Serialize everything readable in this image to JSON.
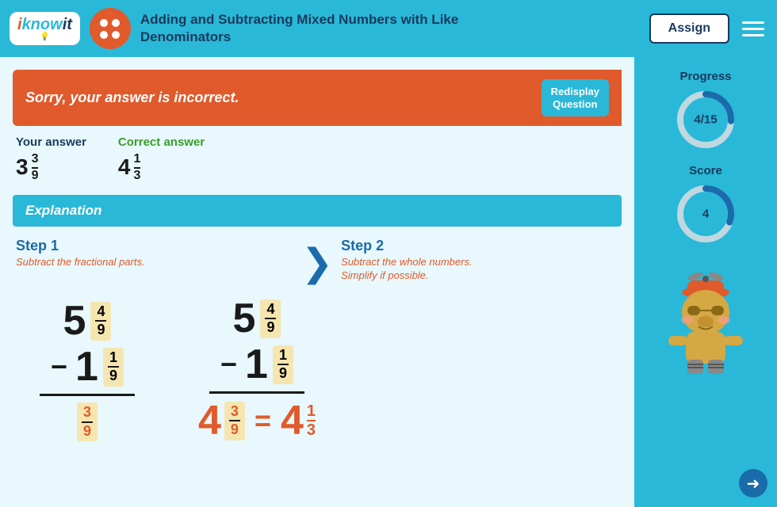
{
  "header": {
    "logo_i": "i",
    "logo_know": "know",
    "logo_it": "it",
    "title_line1": "Adding and Subtracting Mixed Numbers with Like",
    "title_line2": "Denominators",
    "assign_label": "Assign"
  },
  "feedback": {
    "incorrect_text": "Sorry, your answer is incorrect.",
    "redisplay_label": "Redisplay\nQuestion"
  },
  "answers": {
    "your_answer_label": "Your answer",
    "your_whole": "3",
    "your_num": "3",
    "your_den": "9",
    "correct_answer_label": "Correct answer",
    "correct_whole": "4",
    "correct_num": "1",
    "correct_den": "3"
  },
  "explanation": {
    "title": "Explanation"
  },
  "steps": {
    "step1_title": "Step 1",
    "step1_desc": "Subtract the fractional parts.",
    "step2_title": "Step 2",
    "step2_desc": "Subtract the whole numbers.\nSimplify if possible."
  },
  "math": {
    "top_whole": "5",
    "top_num": "4",
    "top_den": "9",
    "bottom_whole": "1",
    "bottom_num": "1",
    "bottom_den": "9",
    "result_num": "3",
    "result_den": "9",
    "final_whole": "4",
    "final_num": "3",
    "final_den": "9",
    "final_simple_whole": "4",
    "final_simple_num": "1",
    "final_simple_den": "3"
  },
  "sidebar": {
    "progress_label": "Progress",
    "progress_text": "4/15",
    "progress_value": 26,
    "score_label": "Score",
    "score_text": "4",
    "score_value": 30
  },
  "icons": {
    "arrow_right": "❯",
    "nav_arrow": "➜"
  }
}
